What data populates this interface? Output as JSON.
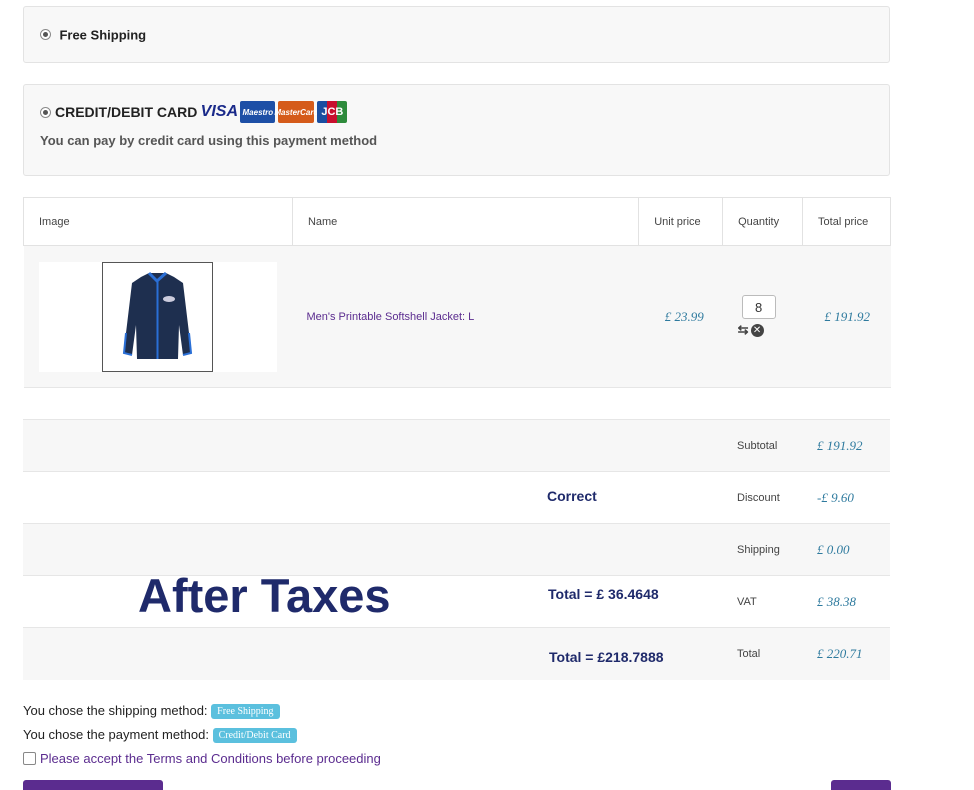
{
  "shipping_option": {
    "label": "Free Shipping"
  },
  "payment_option": {
    "label": "CREDIT/DEBIT CARD",
    "description": "You can pay by credit card using this payment method",
    "cards": [
      "VISA",
      "Maestro",
      "MasterCard",
      "JCB"
    ]
  },
  "cart": {
    "headers": [
      "Image",
      "Name",
      "Unit price",
      "Quantity",
      "Total price"
    ],
    "item": {
      "name": "Men's Printable Softshell Jacket: L",
      "unit_price": "£ 23.99",
      "quantity": "8",
      "total_price": "£ 191.92"
    }
  },
  "totals": {
    "subtotal_label": "Subtotal",
    "subtotal": "£ 191.92",
    "discount_label": "Discount",
    "discount": "-£ 9.60",
    "shipping_label": "Shipping",
    "shipping": "£ 0.00",
    "vat_label": "VAT",
    "vat": "£ 38.38",
    "total_label": "Total",
    "total": "£ 220.71"
  },
  "annotations": {
    "correct": "Correct",
    "after_taxes": "After Taxes",
    "total_a": "Total = £ 36.4648",
    "total_b": "Total = £218.7888"
  },
  "summary": {
    "shipping_text": "You chose the shipping method:",
    "shipping_badge": "Free Shipping",
    "payment_text": "You chose the payment method:",
    "payment_badge": "Credit/Debit Card",
    "terms": "Please accept the Terms and Conditions before proceeding"
  },
  "colors": {
    "price": "#2e7a9e",
    "link": "#5b2c8f",
    "badge": "#5bc0de",
    "annotation": "#1f2a6b"
  }
}
